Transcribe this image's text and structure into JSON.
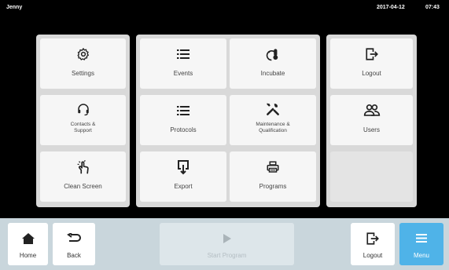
{
  "status": {
    "user": "Jenny",
    "date": "2017-04-12",
    "time": "07:43"
  },
  "tiles": {
    "settings": "Settings",
    "contacts": "Contacts &\nSupport",
    "clean_screen": "Clean Screen",
    "events": "Events",
    "incubate": "Incubate",
    "protocols": "Protocols",
    "maintenance": "Maintenance &\nQualification",
    "export": "Export",
    "programs": "Programs",
    "logout": "Logout",
    "users": "Users"
  },
  "bottom": {
    "home": "Home",
    "back": "Back",
    "start": "Start Program",
    "logout": "Logout",
    "menu": "Menu"
  },
  "colors": {
    "accent": "#4fb3e8",
    "tile_bg": "#f6f6f6",
    "panel_bg": "#d9d9d9",
    "bottom_bar": "#c9d6dc"
  },
  "icons": [
    "gear-icon",
    "headset-icon",
    "touch-hand-icon",
    "list-icon",
    "thermometer-icon",
    "tools-icon",
    "export-icon",
    "printer-icon",
    "logout-icon",
    "users-icon",
    "home-icon",
    "back-arrow-icon",
    "play-icon",
    "menu-icon"
  ]
}
